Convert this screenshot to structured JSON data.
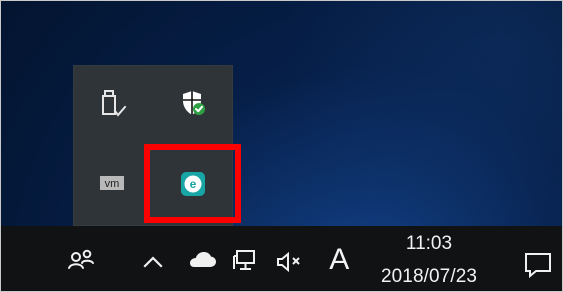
{
  "overflow_tray": {
    "icons": [
      "usb-safely-remove-icon",
      "windows-security-icon",
      "vmware-icon",
      "eset-icon"
    ],
    "vmware_label": "vm",
    "eset_label": "e",
    "highlighted_item": "eset-icon"
  },
  "taskbar": {
    "icons": [
      "people-icon",
      "chevron-up-icon",
      "onedrive-cloud-icon",
      "network-icon",
      "volume-muted-icon",
      "notification-center-icon"
    ],
    "ime_mode": "A",
    "clock_time": "11:03",
    "clock_date": "2018/07/23"
  },
  "colors": {
    "highlight_red": "#ff0000",
    "security_green": "#2ea043",
    "eset_teal": "#18a5a6",
    "taskbar_bg": "#111214",
    "flyout_bg": "#2f3438"
  }
}
